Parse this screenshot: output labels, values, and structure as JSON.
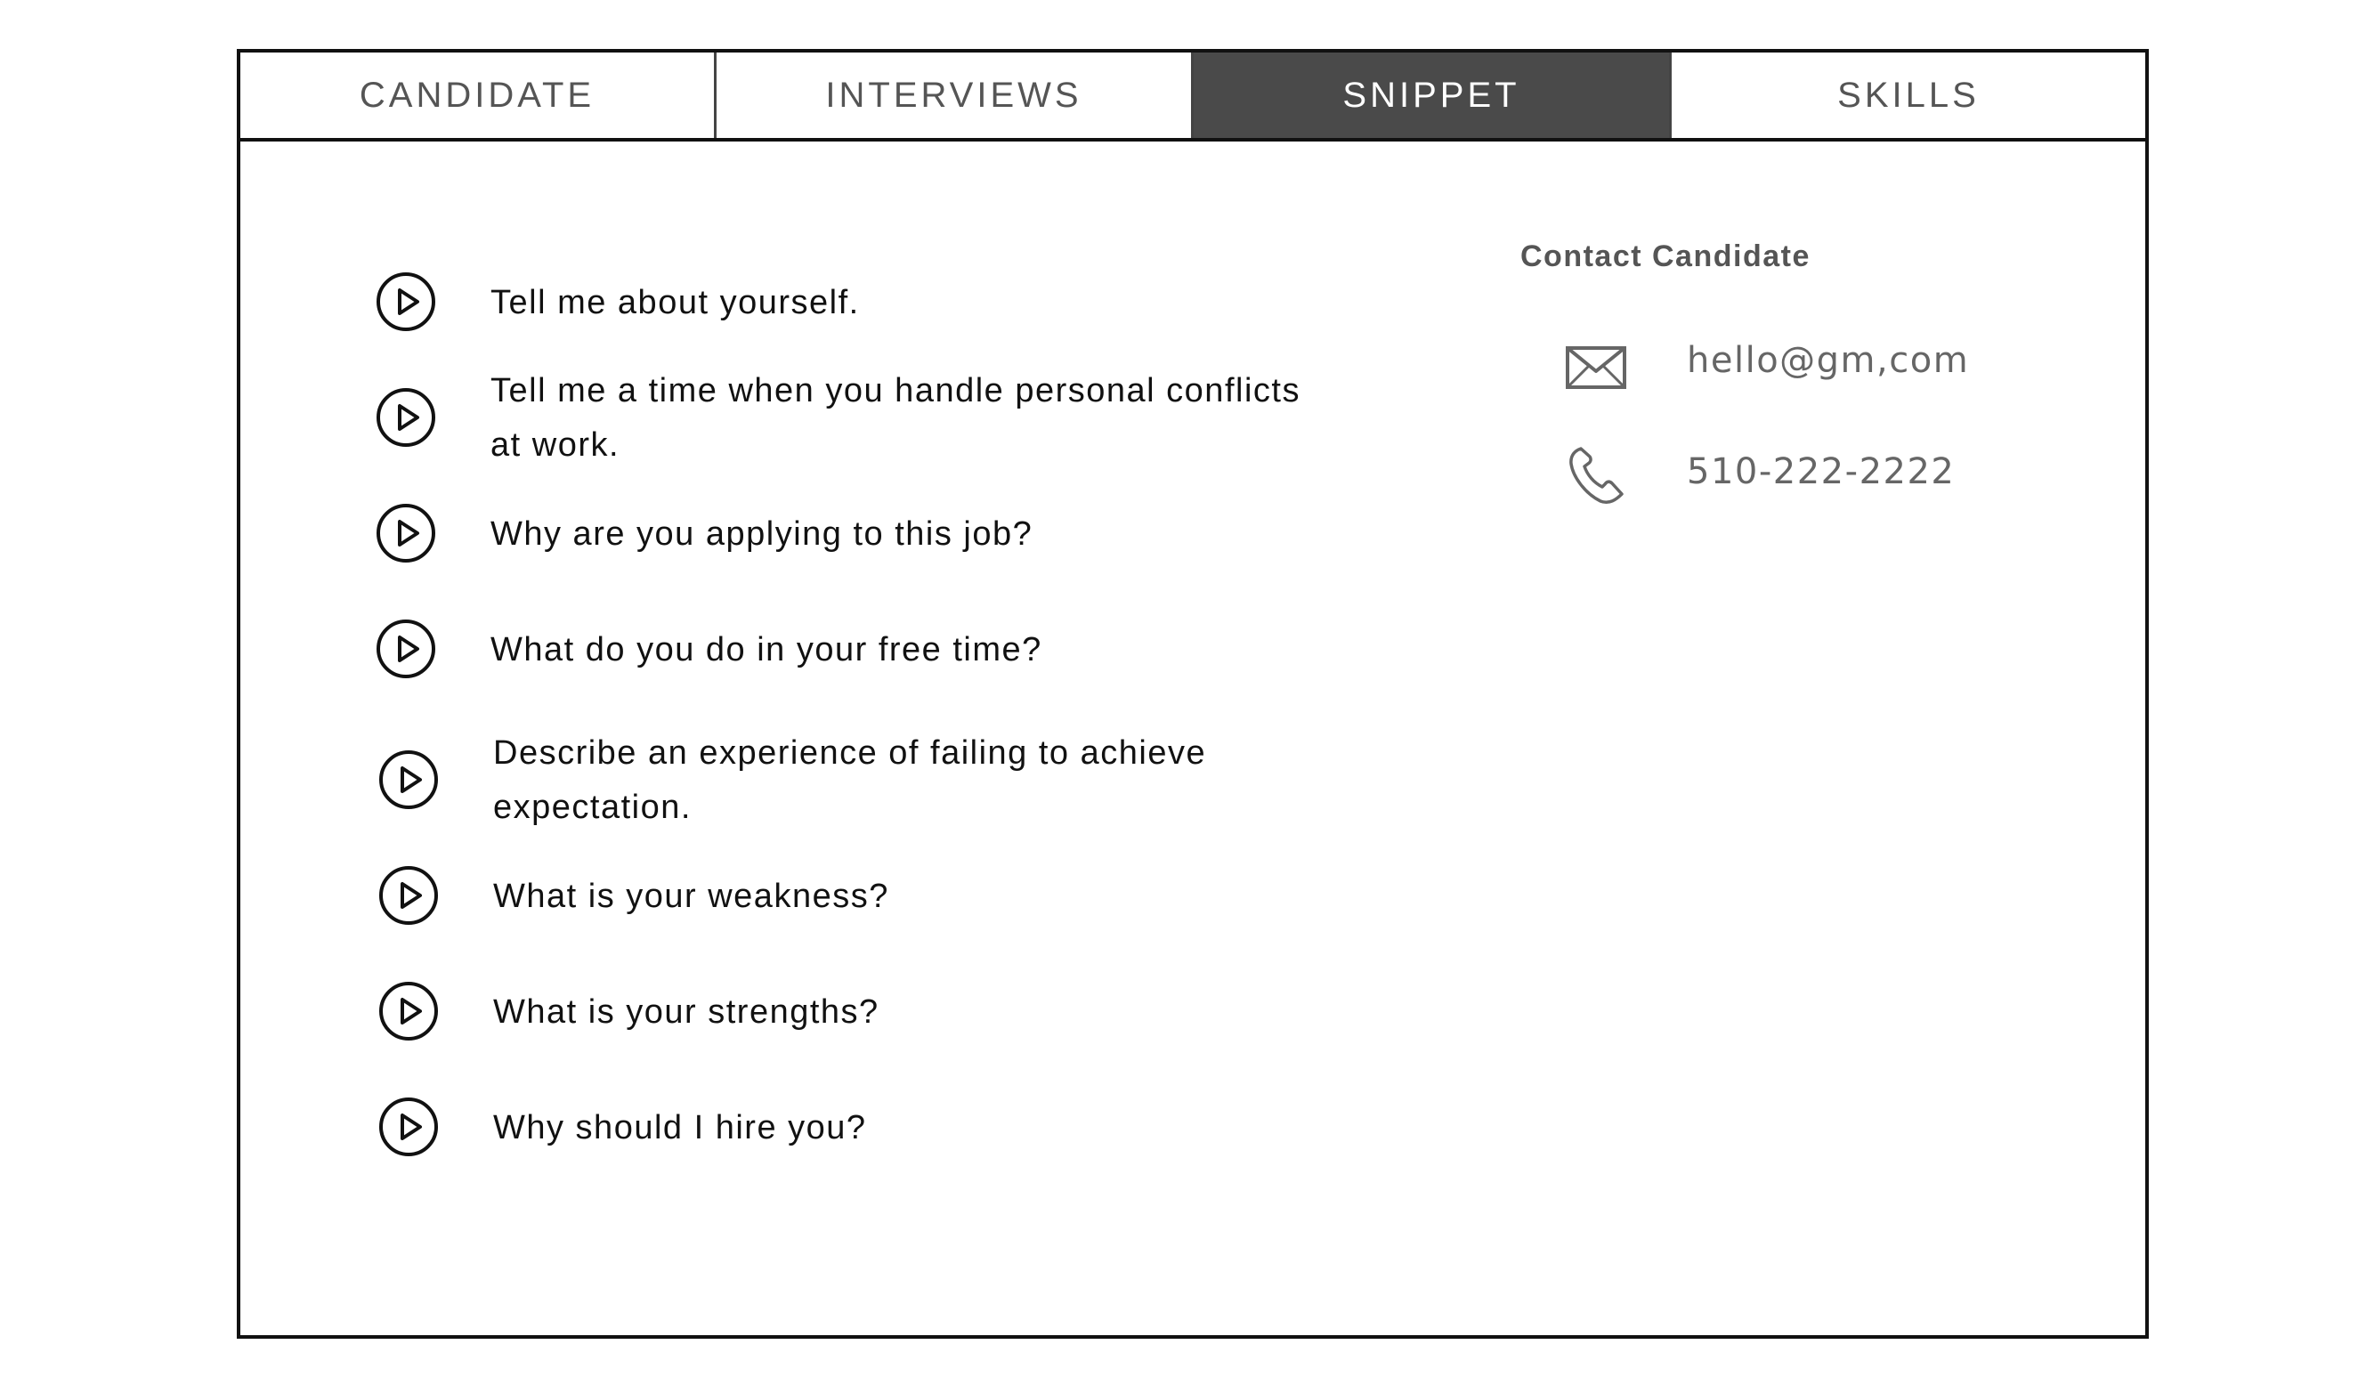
{
  "tabs": [
    {
      "label": "CANDIDATE",
      "active": false
    },
    {
      "label": "INTERVIEWS",
      "active": false
    },
    {
      "label": "SNIPPET",
      "active": true
    },
    {
      "label": "SKILLS",
      "active": false
    }
  ],
  "questions": [
    {
      "text": "Tell me about yourself.",
      "icon": "play-circle-icon"
    },
    {
      "text": "Tell me a time when you handle personal conflicts at work.",
      "icon": "play-circle-icon"
    },
    {
      "text": "Why are you applying to this job?",
      "icon": "play-circle-icon"
    },
    {
      "text": "What do you do in your free time?",
      "icon": "play-circle-icon"
    },
    {
      "text": "Describe an experience of failing to achieve expectation.",
      "icon": "play-circle-icon"
    },
    {
      "text": "What is your weakness?",
      "icon": "play-circle-icon"
    },
    {
      "text": "What is your strengths?",
      "icon": "play-circle-icon"
    },
    {
      "text": "Why should I hire you?",
      "icon": "play-circle-icon"
    }
  ],
  "contact": {
    "title": "Contact Candidate",
    "email": {
      "icon": "envelope-icon",
      "value": "hello@gm,com"
    },
    "phone": {
      "icon": "phone-icon",
      "value": "510-222-2222"
    }
  },
  "colors": {
    "active_tab_bg": "#4a4a4a",
    "border": "#111111",
    "muted_text": "#666666"
  }
}
